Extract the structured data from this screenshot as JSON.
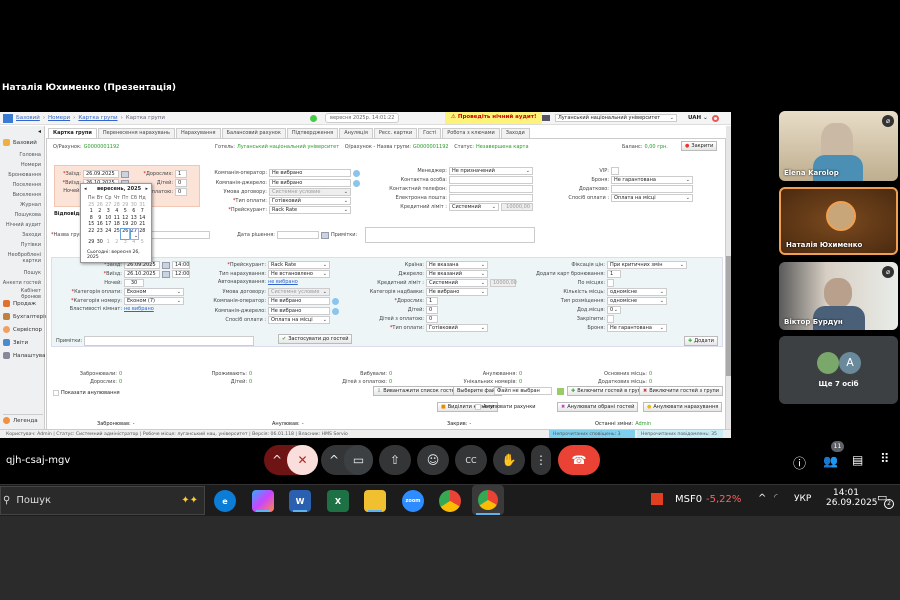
{
  "presentation_title": "Наталія Юхименко (Презентація)",
  "app": {
    "breadcrumb": [
      "Базовий",
      "Номери",
      "Картка групи",
      "Картка групи"
    ],
    "datetime": "вересня 2025р. 14:01:22",
    "audit_warning": "Проведіть нічний аудит!",
    "hotel_select": "Луганський національний університет",
    "currency": "UAH",
    "sidebar": {
      "section": "Базовий",
      "items": [
        "Головна",
        "Номери",
        "Бронювання",
        "Поселення",
        "Виселення",
        "Журнал",
        "Пошукова",
        "Нічний аудит",
        "Заходи",
        "Путівки",
        "Необроблені картки",
        "Пошук",
        "Анкети гостей",
        "Кабінет бронюв"
      ],
      "modules": [
        "Продаж",
        "Бухгалтерія",
        "Сервіспор",
        "Звіти",
        "Налаштування"
      ],
      "legend": "Легенда"
    },
    "tabs": [
      "Картка групи",
      "Перенесення нарахувань",
      "Нарахування",
      "Балансовий рахунок",
      "Підтвердження",
      "Ануляція",
      "Ресс. картки",
      "Гості",
      "Робота з ключами",
      "Заходи"
    ],
    "header_info": {
      "account_label": "О/Рахунок:",
      "account": "G0000001192",
      "hotel_label": "Готель:",
      "hotel": "Луганський національний університет",
      "group_label": "О/рахунок - Назва групи:",
      "group": "G0000001192",
      "status_label": "Статус:",
      "status": "Незавершена карта",
      "balance_label": "Баланс:",
      "balance": "0,00 грн.",
      "close_button": "Закрити"
    },
    "group_form": {
      "arrival_label": "Заїзд:",
      "arrival": "26.09.2025",
      "departure_label": "Виїзд:",
      "departure": "26.10.2025",
      "nights_label": "Ночей:",
      "adults_label": "Дорослих:",
      "adults": "1",
      "children_label": "Дітей:",
      "children": "0",
      "paid_children_label": "з оплатою:",
      "paid_children": "0",
      "responsible_label": "Відповідальний",
      "operator_label": "Компанія-оператор:",
      "operator": "Не вибрано",
      "source_label": "Компанія-джерело:",
      "source": "Не вибрано",
      "contract_label": "Умова договору:",
      "contract": "Системне условие",
      "payment_type_label": "Тип оплати:",
      "payment_type": "Готівковий",
      "pricelist_label": "Прейскурант:",
      "pricelist": "Rack Rate",
      "manager_label": "Менеджер:",
      "manager": "Не призначений",
      "contact_label": "Контактна особа:",
      "phone_label": "Контактний телефон:",
      "email_label": "Електронна пошта:",
      "credit_label": "Кредитний ліміт :",
      "credit": "Системний",
      "credit_amount": "10000,00",
      "vip_label": "VIP:",
      "booking_label": "Броня:",
      "booking": "Не гарантована",
      "extra_label": "Додатково:",
      "pay_method_label": "Спосіб оплати :",
      "pay_method": "Оплата на місці",
      "group_name_label": "Назва групи:",
      "decision_date_label": "Дата рішення:",
      "notes_label": "Примітки:"
    },
    "calendar": {
      "month": "вересень, 2025",
      "weekdays": [
        "Пн",
        "Вт",
        "Ср",
        "Чт",
        "Пт",
        "Сб",
        "Нд"
      ],
      "weeks": [
        [
          "25",
          "26",
          "27",
          "28",
          "29",
          "30",
          "31"
        ],
        [
          "1",
          "2",
          "3",
          "4",
          "5",
          "6",
          "7"
        ],
        [
          "8",
          "9",
          "10",
          "11",
          "12",
          "13",
          "14"
        ],
        [
          "15",
          "16",
          "17",
          "18",
          "19",
          "20",
          "21"
        ],
        [
          "22",
          "23",
          "24",
          "25",
          "26",
          "27",
          "28"
        ],
        [
          "29",
          "30",
          "1",
          "2",
          "3",
          "4",
          "5"
        ]
      ],
      "today_label": "Сьогодні: вересня 26, 2025"
    },
    "guest_form": {
      "arrival_label": "Заїзд:",
      "arrival": "26.09.2025",
      "arrival_time": "14:00",
      "departure_label": "Виїзд:",
      "departure": "26.10.2025",
      "departure_time": "12:00",
      "nights_label": "Ночей:",
      "nights": "30",
      "pay_category_label": "Категорія оплати:",
      "pay_category": "Економ",
      "room_category_label": "Категорія номеру:",
      "room_category": "Економ (7)",
      "room_props_label": "Властивості кімнат:",
      "room_props": "не вибрано",
      "pricelist_label": "Прейскурант:",
      "pricelist": "Rack Rate",
      "charge_type_label": "Тип нарахування:",
      "charge_type": "Не встановлено",
      "auto_charge_label": "Автонарахування:",
      "auto_charge": "не вибрано",
      "contract_label": "Умова договору:",
      "contract": "Системне условие",
      "operator_label": "Компанія-оператор:",
      "operator": "Не вибрано",
      "source_label": "Компанія-джерело:",
      "source": "Не вибрано",
      "pay_method_label": "Спосіб оплати :",
      "pay_method": "Оплата на місці",
      "country_label": "Країна:",
      "country": "Не вказана",
      "origin_label": "Джерело:",
      "origin": "Не вказаний",
      "credit_label": "Кредитний ліміт :",
      "credit": "Системний",
      "credit_amount": "10000,00",
      "discount_label": "Категорія надбавки:",
      "discount": "Не вибрано",
      "adults_label": "Дорослих:",
      "adults": "1",
      "children_label": "Дітей:",
      "children": "0",
      "paid_children_label": "Дітей з оплатою:",
      "paid_children": "0",
      "payment_type_label": "Тип оплати:",
      "payment_type": "Готівковий",
      "price_fix_label": "Фіксація цін:",
      "price_fix": "При критичних змін",
      "add_cards_label": "Додати карт бронювання:",
      "add_cards": "1",
      "by_seats_label": "По місцях:",
      "seats_count_label": "Кількість місць:",
      "seats_count": "одномісне",
      "placement_label": "Тип розміщення:",
      "placement": "одномісне",
      "extra_seats_label": "Дод.місця:",
      "extra_seats": "0",
      "lock_label": "Закріпити:",
      "booking_label": "Броня:",
      "booking": "Не гарантована",
      "notes_label": "Примітки:",
      "apply_button": "Застосувати до гостей",
      "add_button": "Додати"
    },
    "stats": [
      {
        "label": "Забронювали:",
        "value": "0"
      },
      {
        "label": "Дорослих:",
        "value": "0"
      },
      {
        "label": "Проживають:",
        "value": "0"
      },
      {
        "label": "Дітей:",
        "value": "0"
      },
      {
        "label": "Вибували:",
        "value": "0"
      },
      {
        "label": "Дітей з оплатою:",
        "value": "0"
      },
      {
        "label": "Анулювання:",
        "value": "0"
      },
      {
        "label": "Унікальних номерів:",
        "value": "0"
      },
      {
        "label": "Основних місць:",
        "value": "0"
      },
      {
        "label": "Додаткових місць:",
        "value": "0"
      }
    ],
    "show_cancelled": "Показати анулювання",
    "actions": {
      "export_guests": "Вивантажити список гостей",
      "choose_file": "Выберите файл",
      "no_file": "Файл не выбран",
      "include_guests": "Включити гостей в групу",
      "exclude_guests": "Виключити гостей з групи",
      "allocate_rooms": "Виділити кімнати",
      "cancel_accounts": "Анулювати рахунки",
      "cancel_selected": "Анулювати обрані гостей",
      "cancel_charges": "Анулювати нарахування"
    },
    "footer_info": {
      "booked_label": "Забронював:",
      "booked": "-",
      "cancelled_label": "Анулював:",
      "cancelled": "-",
      "closed_label": "Закрив:",
      "closed": "-",
      "last_change_label": "Останні зміни:",
      "last_change": "Admin"
    },
    "statusbar": {
      "user": "Користувач: Admin",
      "status": "Статус: Системний адміністратор",
      "workplace": "Робоче місце: луганський нац. університет",
      "version": "Версія: 06.01.118",
      "owner": "Власник: HMS Servio",
      "unread_alerts": "Непрочитаних сповіщень: 3",
      "unread_messages": "Непрочитаних повідомлень: 35"
    }
  },
  "participants": [
    {
      "name": "Elena Karolop",
      "muted": true
    },
    {
      "name": "Наталія Юхименко",
      "muted": false,
      "speaking": true
    },
    {
      "name": "Віктор Бурдун",
      "muted": true
    },
    {
      "name": "Ще 7 осіб",
      "avatar_letter": "A"
    }
  ],
  "meet": {
    "meeting_code": "qjh-csaj-mgv",
    "participants_count": "11",
    "colors": {
      "end_call": "#ea4335",
      "mic_off": "#f9dedc",
      "accent_border": "#f0a050"
    }
  },
  "taskbar": {
    "search": "Пошук",
    "apps": [
      "edge",
      "copilot",
      "word",
      "excel",
      "explorer",
      "zoom",
      "chrome",
      "chrome-profile"
    ],
    "stock": "MSF0",
    "stock_change": "-5,22%",
    "lang": "УКР",
    "time": "14:01",
    "date": "26.09.2025",
    "notifications": "2"
  }
}
